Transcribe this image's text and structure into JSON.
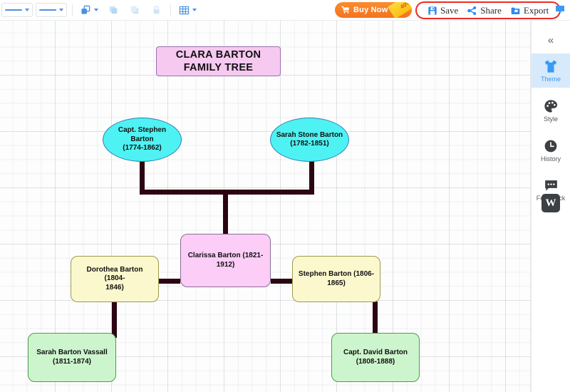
{
  "toolbar": {
    "tools": [
      {
        "name": "line-style-dropdown",
        "icon": "line-icon"
      },
      {
        "name": "line-weight-dropdown",
        "icon": "line-icon"
      },
      {
        "name": "shape-arrange-dropdown",
        "icon": "shapes-icon"
      },
      {
        "name": "bring-forward-button",
        "icon": "bring-forward-icon"
      },
      {
        "name": "send-backward-button",
        "icon": "send-backward-icon"
      },
      {
        "name": "lock-button",
        "icon": "lock-icon"
      },
      {
        "name": "table-dropdown",
        "icon": "table-icon"
      }
    ],
    "buy_now": {
      "label": "Buy Now",
      "discount": "40%",
      "icon": "cart-icon"
    },
    "actions": [
      {
        "label": "Save",
        "icon": "save-icon"
      },
      {
        "label": "Share",
        "icon": "share-icon"
      },
      {
        "label": "Export",
        "icon": "export-folder-icon"
      }
    ],
    "highlight_color": "#ee2b24",
    "accent_color": "#4a90e2"
  },
  "sidebar": {
    "collapse_glyph": "«",
    "items": [
      {
        "label": "Theme",
        "icon": "tshirt-icon",
        "active": true
      },
      {
        "label": "Style",
        "icon": "palette-icon",
        "active": false
      },
      {
        "label": "History",
        "icon": "clock-icon",
        "active": false
      },
      {
        "label": "FeedBack",
        "icon": "chat-bubble-icon",
        "active": false
      }
    ],
    "badge": {
      "label": "W",
      "name": "watermark-badge"
    }
  },
  "diagram": {
    "title": {
      "line1": "CLARA BARTON",
      "line2": "FAMILY TREE",
      "fill": "#f6c9f1",
      "stroke": "#9b6fb0"
    },
    "nodes": [
      {
        "id": "father",
        "shape": "ellipse",
        "line1": "Capt. Stephen Barton",
        "line2": "(1774-1862)",
        "fill": "#4ff2f2",
        "stroke": "#2f7fb5"
      },
      {
        "id": "mother",
        "shape": "ellipse",
        "line1": "Sarah Stone Barton",
        "line2": "(1782-1851)",
        "fill": "#4ff2f2",
        "stroke": "#2f7fb5"
      },
      {
        "id": "clara",
        "shape": "rounded-rect",
        "line1": "Clarissa Barton (1821-",
        "line2": "1912)",
        "fill": "#fbcdf7",
        "stroke": "#8a6e97"
      },
      {
        "id": "dorothea",
        "shape": "rounded-rect",
        "line1": "Dorothea Barton (1804-",
        "line2": "1846)",
        "fill": "#fbf8cd",
        "stroke": "#9e9a4e"
      },
      {
        "id": "stephen",
        "shape": "rounded-rect",
        "line1": "Stephen Barton (1806-",
        "line2": "1865)",
        "fill": "#fbf8cd",
        "stroke": "#9e9a4e"
      },
      {
        "id": "sarah_vassall",
        "shape": "rounded-rect",
        "line1": "Sarah Barton Vassall",
        "line2": "(1811-1874)",
        "fill": "#cdf5cd",
        "stroke": "#4f9a4f"
      },
      {
        "id": "david",
        "shape": "rounded-rect",
        "line1": "Capt. David Barton",
        "line2": "(1808-1888)",
        "fill": "#cdf5cd",
        "stroke": "#4f9a4f"
      }
    ],
    "connector_color": "#2c0512"
  }
}
